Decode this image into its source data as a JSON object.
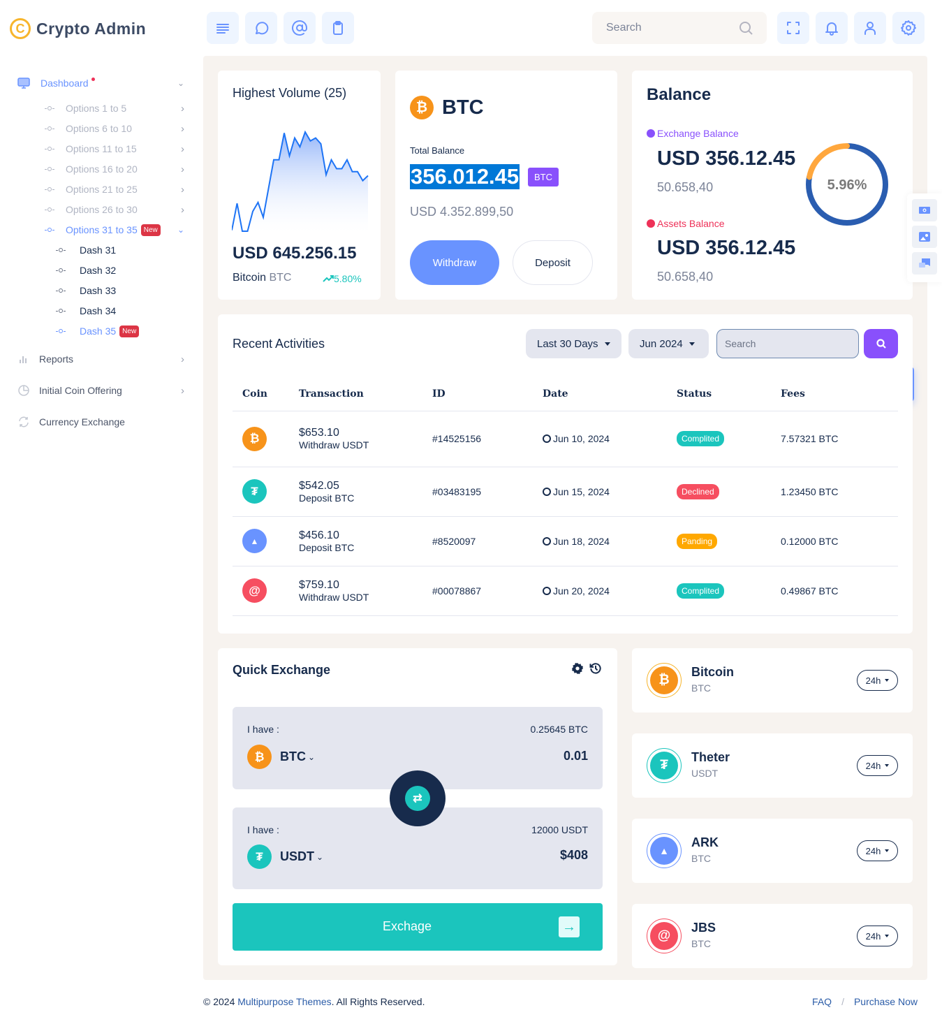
{
  "app": {
    "logo_glyph": "C",
    "title": "Crypto Admin"
  },
  "topbar": {
    "left_icons": [
      "menu-icon",
      "chat-bubble-icon",
      "at-sign-icon",
      "clipboard-icon"
    ],
    "search_placeholder": "Search",
    "right_icons": [
      "fullscreen-icon",
      "bell-icon",
      "user-icon",
      "settings-gear-icon"
    ]
  },
  "sidebar": {
    "dashboard": {
      "label": "Dashboard",
      "icon": "monitor-icon",
      "has_dot": true
    },
    "options": [
      {
        "label": "Options 1 to 5"
      },
      {
        "label": "Options 6 to 10"
      },
      {
        "label": "Options 11 to 15"
      },
      {
        "label": "Options 16 to 20"
      },
      {
        "label": "Options 21 to 25"
      },
      {
        "label": "Options 26 to 30"
      },
      {
        "label": "Options 31 to 35",
        "badge": "New",
        "active": true
      }
    ],
    "dashes": [
      {
        "label": "Dash 31"
      },
      {
        "label": "Dash 32"
      },
      {
        "label": "Dash 33"
      },
      {
        "label": "Dash 34"
      },
      {
        "label": "Dash 35",
        "badge": "New",
        "active": true
      }
    ],
    "main_items": [
      {
        "label": "Reports",
        "icon": "bar-chart-icon"
      },
      {
        "label": "Initial Coin Offering",
        "icon": "pie-chart-icon"
      },
      {
        "label": "Currency Exchange",
        "icon": "refresh-icon"
      }
    ]
  },
  "highest_volume": {
    "title": "Highest Volume (25)",
    "amount": "USD 645.256.15",
    "coin_name": "Bitcoin",
    "coin_symbol": "BTC",
    "change": "5.80%",
    "sparkline": [
      1,
      28,
      0,
      0,
      20,
      29,
      14,
      43,
      72,
      72,
      99,
      76,
      94,
      85,
      100,
      91,
      94,
      88,
      57,
      72,
      63,
      63,
      72,
      60,
      60,
      51,
      56
    ]
  },
  "btc_card": {
    "symbol": "BTC",
    "total_balance_label": "Total Balance",
    "total_balance": "356.012.45",
    "badge": "BTC",
    "usd_value": "USD 4.352.899,50",
    "withdraw_label": "Withdraw",
    "deposit_label": "Deposit"
  },
  "balance": {
    "title": "Balance",
    "exchange": {
      "label": "Exchange Balance",
      "amount": "USD 356.12.45",
      "sub": "50.658,40",
      "color": "#8e44ff"
    },
    "assets": {
      "label": "Assets Balance",
      "amount": "USD 356.12.45",
      "sub": "50.658,40",
      "color": "#ee3158"
    },
    "donut": {
      "label": "5.96%",
      "segments": [
        {
          "name": "primary",
          "value": 78,
          "color": "#2a5db0"
        },
        {
          "name": "secondary",
          "value": 22,
          "color": "#ffa73d"
        }
      ]
    }
  },
  "activities": {
    "title": "Recent Activities",
    "range_filter": "Last 30 Days",
    "month_filter": "Jun 2024",
    "search_placeholder": "Search",
    "columns": [
      "Coin",
      "Transaction",
      "ID",
      "Date",
      "Status",
      "Fees"
    ],
    "rows": [
      {
        "coin": "bitcoin",
        "amount": "$653.10",
        "type": "Withdraw USDT",
        "id": "#14525156",
        "date": "Jun 10, 2024",
        "status": "Complited",
        "status_color": "#1bc5bd",
        "fees": "7.57321 BTC"
      },
      {
        "coin": "tether",
        "amount": "$542.05",
        "type": "Deposit BTC",
        "id": "#03483195",
        "date": "Jun 15, 2024",
        "status": "Declined",
        "status_color": "#f64e60",
        "fees": "1.23450 BTC"
      },
      {
        "coin": "ark",
        "amount": "$456.10",
        "type": "Deposit BTC",
        "id": "#8520097",
        "date": "Jun 18, 2024",
        "status": "Panding",
        "status_color": "#ffa800",
        "fees": "0.12000 BTC"
      },
      {
        "coin": "jbs",
        "amount": "$759.10",
        "type": "Withdraw USDT",
        "id": "#00078867",
        "date": "Jun 20, 2024",
        "status": "Complited",
        "status_color": "#1bc5bd",
        "fees": "0.49867 BTC"
      }
    ]
  },
  "quick_exchange": {
    "title": "Quick Exchange",
    "from": {
      "label": "I have :",
      "balance": "0.25645 BTC",
      "coin": "BTC",
      "amount": "0.01"
    },
    "to": {
      "label": "I have :",
      "balance": "12000 USDT",
      "coin": "USDT",
      "amount": "$408"
    },
    "button_label": "Exchage"
  },
  "coin_list": [
    {
      "name": "Bitcoin",
      "symbol": "BTC",
      "period": "24h",
      "color": "#f7931a",
      "ring": "#f7b52c",
      "glyph": "B"
    },
    {
      "name": "Theter",
      "symbol": "USDT",
      "period": "24h",
      "color": "#1bc5bd",
      "ring": "#1bc5bd",
      "glyph": "T"
    },
    {
      "name": "ARK",
      "symbol": "BTC",
      "period": "24h",
      "color": "#6993ff",
      "ring": "#6993ff",
      "glyph": "A"
    },
    {
      "name": "JBS",
      "symbol": "BTC",
      "period": "24h",
      "color": "#f64e60",
      "ring": "#f64e60",
      "glyph": "J"
    }
  ],
  "footer": {
    "copyright_prefix": "© 2024 ",
    "company": "Multipurpose Themes",
    "copyright_suffix": ". All Rights Reserved.",
    "links": [
      "FAQ",
      "Purchase Now"
    ],
    "separator": "/"
  }
}
